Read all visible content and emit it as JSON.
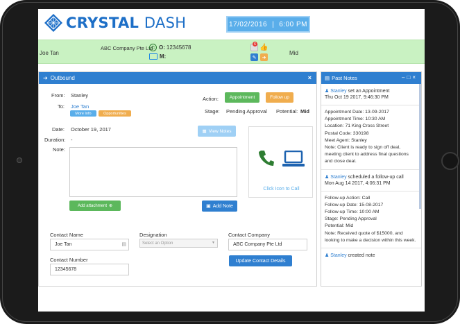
{
  "header": {
    "logo_word1": "CRYSTAL",
    "logo_word2": "DASH",
    "date": "17/02/2016",
    "separator": "|",
    "time": "6:00 PM"
  },
  "infobar": {
    "contact_name": "Joe Tan",
    "company": "ABC Company Pte Ltd",
    "office_prefix": "O:",
    "office_phone": "12345678",
    "mobile_prefix": "M:",
    "mobile_phone": "",
    "notification_count": "6",
    "potential": "Mid"
  },
  "outbound": {
    "title": "Outbound",
    "from_label": "From:",
    "from_value": "Stanley",
    "to_label": "To:",
    "to_value": "Joe Tan",
    "more_info_label": "More Info",
    "opportunities_label": "Opportunities",
    "action_label": "Action:",
    "appointment_label": "Appointment",
    "follow_up_label": "Follow up",
    "stage_label": "Stage:",
    "stage_value": "Pending Approval",
    "potential_label": "Potential:",
    "potential_value": "Mid",
    "date_label": "Date:",
    "date_value": "October 19, 2017",
    "view_notes_label": "View Notes",
    "duration_label": "Duration:",
    "duration_value": "-",
    "note_label": "Note:",
    "note_value": "",
    "click_to_call": "Click Icon to Call",
    "add_attachment_label": "Add attachment",
    "add_note_label": "Add Note",
    "contact_name_label": "Contact Name",
    "contact_name_value": "Joe Tan",
    "designation_label": "Designation",
    "designation_placeholder": "Select an Option",
    "contact_company_label": "Contact Company",
    "contact_company_value": "ABC Company Pte Ltd",
    "contact_number_label": "Contact Number",
    "contact_number_value": "12345678",
    "update_button_label": "Update Contact Details"
  },
  "past_notes": {
    "title": "Past Notes",
    "entries": [
      {
        "who": "Stanley",
        "action": "set an Appointment",
        "when": "Thu Oct 19 2017, 9:46:30 PM",
        "lines": [
          "Appointment Date: 13-09-2017",
          "Appointment Time: 10:30 AM",
          "Location: 71 King Cross Street",
          "Postal Code: 330198",
          "Meet Agent: Stanley",
          "Note: Client is ready to sign off deal, meeting client to address final questions and close deal."
        ]
      },
      {
        "who": "Stanley",
        "action": "scheduled a follow-up call",
        "when": "Mon Aug 14 2017, 4:06:31 PM",
        "lines": [
          "Follow-up Action: Call",
          "Follow-up Date: 15-08-2017",
          "Follow-up Time: 10:00 AM",
          "Stage: Pending Approval",
          "Potential: Mid",
          "Note: Received quote of $15000, and looking to make a decision within this week."
        ]
      },
      {
        "who": "Stanley",
        "action": "created note",
        "when": "",
        "lines": []
      }
    ]
  },
  "colors": {
    "brand_blue": "#2f7fd0",
    "green_bar": "#c9f2c2",
    "appointment_green": "#5cb85c",
    "follow_up_orange": "#f0ad4e"
  }
}
